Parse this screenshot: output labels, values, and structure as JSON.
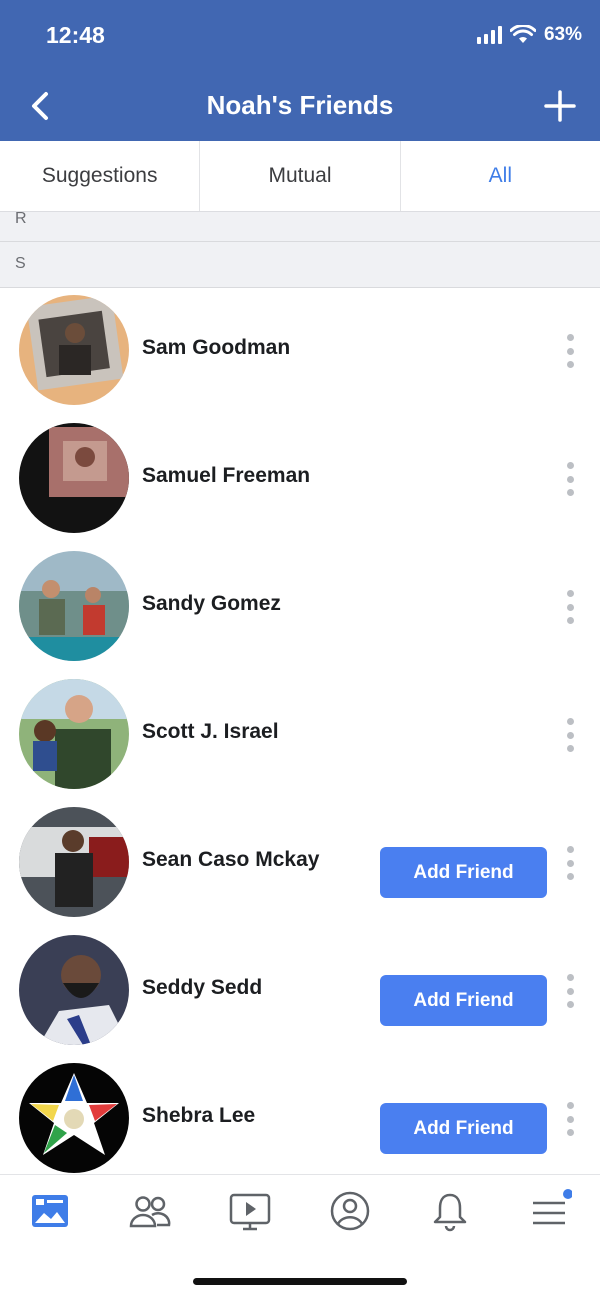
{
  "status_bar": {
    "time": "12:48",
    "battery": "63%"
  },
  "header": {
    "title": "Noah's Friends",
    "back_icon": "back-chevron-icon",
    "add_icon": "plus-icon"
  },
  "tabs": [
    {
      "label": "Suggestions",
      "active": false
    },
    {
      "label": "Mutual",
      "active": false
    },
    {
      "label": "All",
      "active": true
    }
  ],
  "sections": {
    "r": "R",
    "s": "S"
  },
  "friends": [
    {
      "name": "Sam Goodman",
      "add_friend": false
    },
    {
      "name": "Samuel Freeman",
      "add_friend": false
    },
    {
      "name": "Sandy Gomez",
      "add_friend": false
    },
    {
      "name": "Scott J. Israel",
      "add_friend": false
    },
    {
      "name": "Sean Caso Mckay",
      "add_friend": true,
      "button_label": "Add Friend"
    },
    {
      "name": "Seddy Sedd",
      "add_friend": true,
      "button_label": "Add Friend"
    },
    {
      "name": "Shebra Lee",
      "add_friend": true,
      "button_label": "Add Friend"
    }
  ],
  "bottom_nav": [
    "news-feed-icon",
    "friends-icon",
    "watch-icon",
    "profile-icon",
    "notifications-icon",
    "menu-icon"
  ],
  "colors": {
    "brand": "#4167b2",
    "button": "#4a7ff0",
    "active_tab": "#3f7de8",
    "notification_dot": "#3f7de8"
  }
}
